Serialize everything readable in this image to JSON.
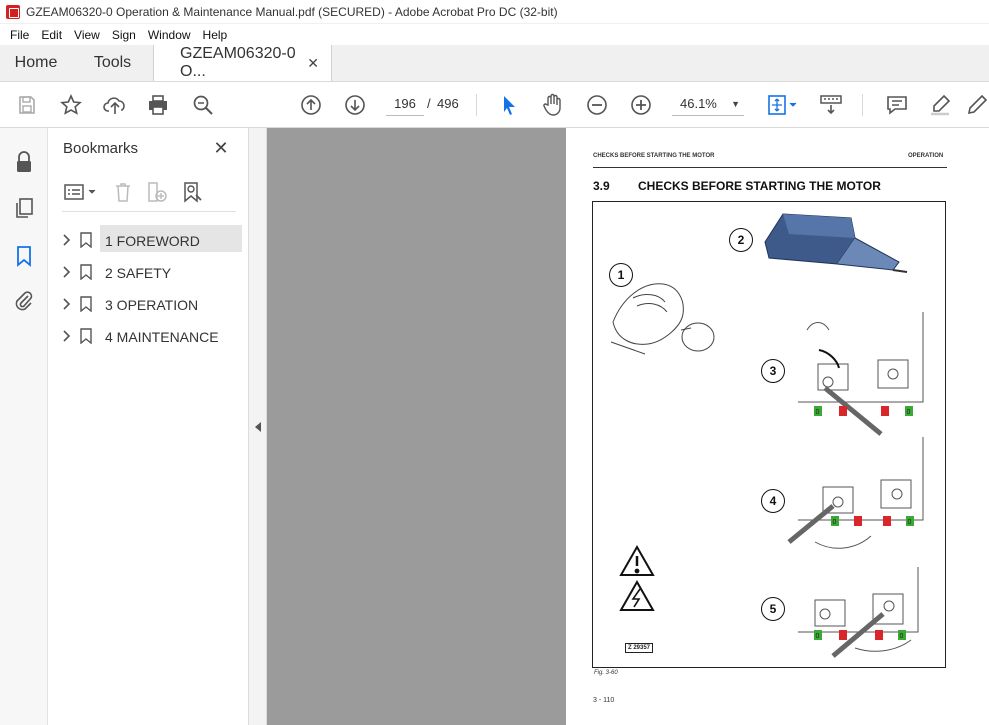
{
  "window": {
    "title": "GZEAM06320-0 Operation & Maintenance Manual.pdf (SECURED) - Adobe Acrobat Pro DC (32-bit)"
  },
  "menu": [
    "File",
    "Edit",
    "View",
    "Sign",
    "Window",
    "Help"
  ],
  "tabs": {
    "home": "Home",
    "tools": "Tools",
    "document": "GZEAM06320-0 O...",
    "close": "✕"
  },
  "toolbar": {
    "page_current": "196",
    "page_separator": "/",
    "page_total": "496",
    "zoom": "46.1%"
  },
  "bookmarks": {
    "title": "Bookmarks",
    "close": "✕",
    "items": [
      {
        "label": "1 FOREWORD",
        "selected": true
      },
      {
        "label": "2 SAFETY",
        "selected": false
      },
      {
        "label": "3 OPERATION",
        "selected": false
      },
      {
        "label": "4 MAINTENANCE",
        "selected": false
      }
    ]
  },
  "page": {
    "header_left": "CHECKS BEFORE STARTING THE MOTOR",
    "header_right": "OPERATION",
    "section_number": "3.9",
    "section_title": "CHECKS BEFORE STARTING THE MOTOR",
    "callouts": [
      "1",
      "2",
      "3",
      "4",
      "5"
    ],
    "switch_marks": [
      "0",
      "0",
      "0",
      "0",
      "0",
      "0"
    ],
    "figure_code": "Z 29357",
    "figure_caption": "Fig. 3-60",
    "page_number": "3 - 110"
  },
  "colors": {
    "accent_blue": "#1473e6",
    "pdf_red": "#d32020",
    "switch_green": "#3aaa35",
    "switch_red": "#d8262b",
    "battery_blue": "#3d5a8a"
  },
  "icons": {
    "rail": [
      "lock-icon",
      "pages-icon",
      "bookmark-icon",
      "attachment-icon"
    ],
    "toolbar": [
      "save-icon",
      "star-icon",
      "upload-icon",
      "print-icon",
      "zoom-search-icon",
      "page-up-icon",
      "page-down-icon",
      "select-cursor-icon",
      "hand-icon",
      "zoom-out-icon",
      "zoom-in-icon",
      "fit-page-icon",
      "scroll-mode-icon",
      "comment-icon",
      "highlight-icon",
      "draw-icon"
    ]
  }
}
